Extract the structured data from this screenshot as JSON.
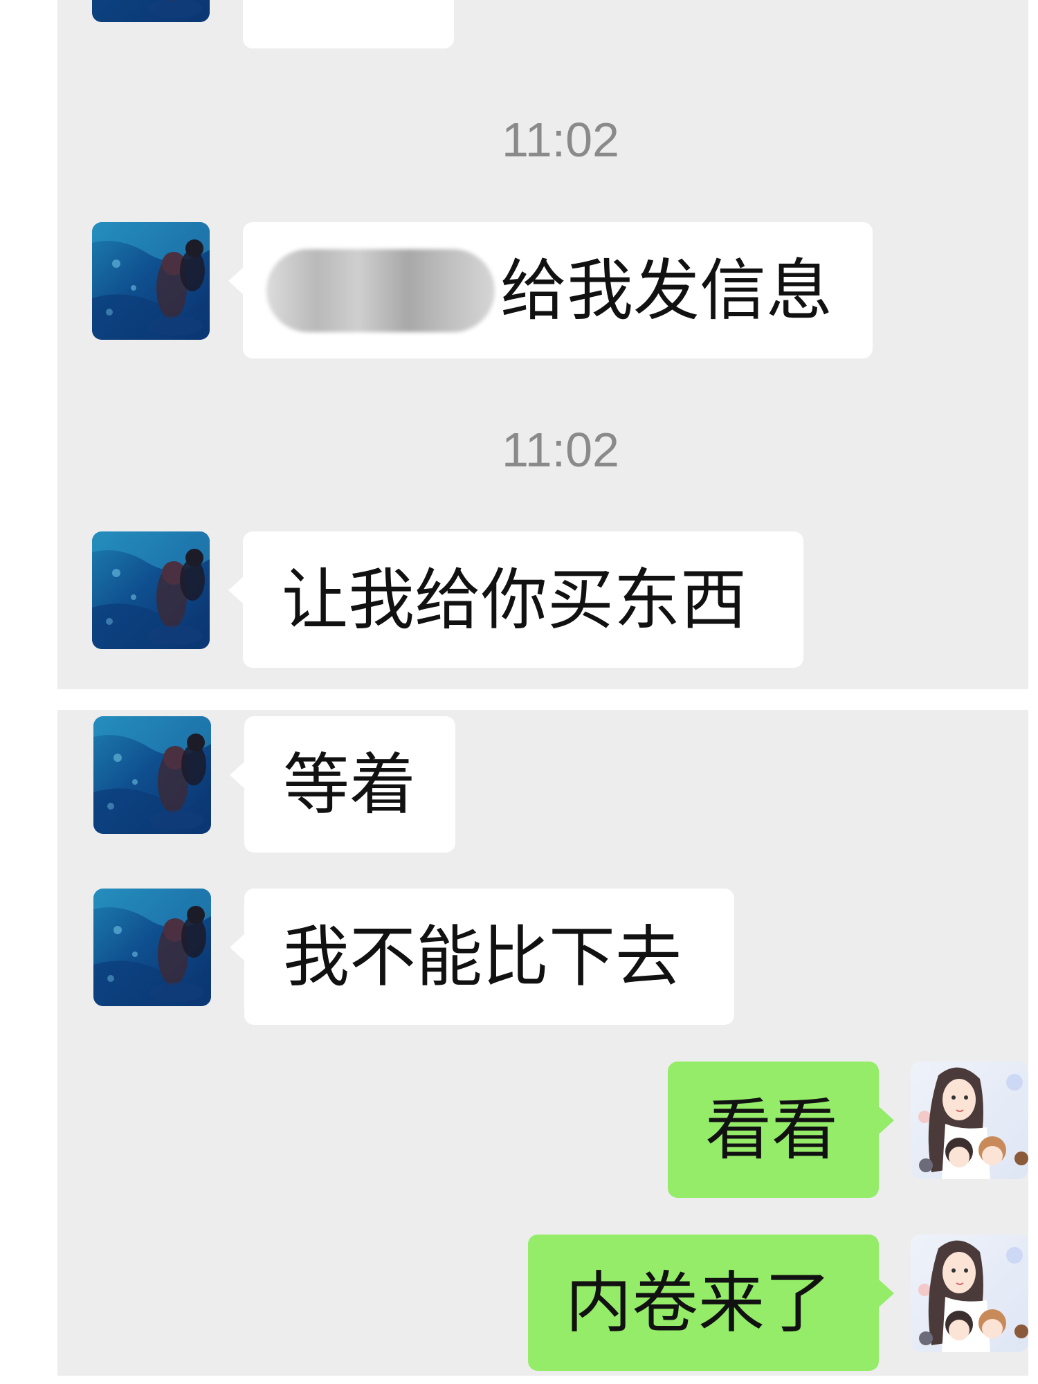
{
  "chat": {
    "timestamps": [
      "11:02",
      "11:02"
    ],
    "messages": [
      {
        "sender": "friend",
        "text": ""
      },
      {
        "sender": "friend",
        "text": "给我发信息",
        "redacted_prefix": true
      },
      {
        "sender": "friend",
        "text": "让我给你买东西"
      },
      {
        "sender": "friend",
        "text": "等着"
      },
      {
        "sender": "friend",
        "text": "我不能比下去"
      },
      {
        "sender": "self",
        "text": "看看"
      },
      {
        "sender": "self",
        "text": "内卷来了"
      }
    ]
  },
  "avatars": {
    "friend": "aquarium-photo-avatar",
    "self": "cartoon-mother-kids-avatar"
  },
  "colors": {
    "background": "#ededed",
    "incoming_bubble": "#ffffff",
    "outgoing_bubble": "#95ec69",
    "timestamp": "#8a8a8a"
  }
}
